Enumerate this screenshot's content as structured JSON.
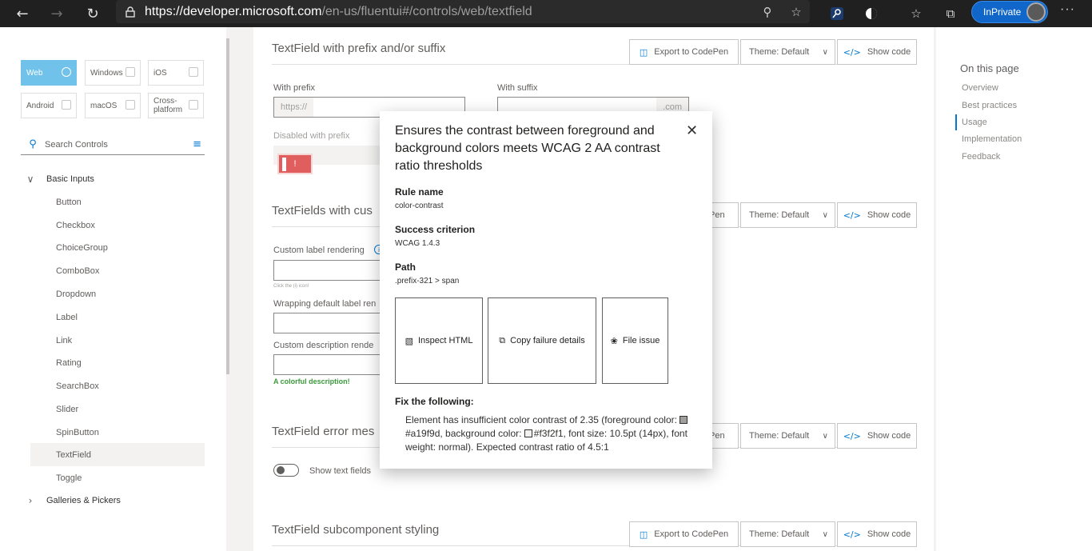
{
  "browser": {
    "url_host": "https://developer.microsoft.com",
    "url_path": "/en-us/fluentui#/controls/web/textfield",
    "inprivate_label": "InPrivate"
  },
  "platforms": [
    {
      "label": "Web",
      "active": true
    },
    {
      "label": "Windows"
    },
    {
      "label": "iOS"
    },
    {
      "label": "Android"
    },
    {
      "label": "macOS"
    },
    {
      "label": "Cross-platform"
    }
  ],
  "search": {
    "placeholder": "Search Controls"
  },
  "nav": {
    "group_basic": "Basic Inputs",
    "items": [
      "Button",
      "Checkbox",
      "ChoiceGroup",
      "ComboBox",
      "Dropdown",
      "Label",
      "Link",
      "Rating",
      "SearchBox",
      "Slider",
      "SpinButton",
      "TextField",
      "Toggle"
    ],
    "selected": "TextField",
    "group_galleries": "Galleries & Pickers"
  },
  "sections": [
    {
      "title": "TextField with prefix and/or suffix"
    },
    {
      "title": "TextFields with cus"
    },
    {
      "title": "TextField error mes"
    },
    {
      "title": "TextField subcomponent styling"
    }
  ],
  "toolbar": {
    "export_label": "Export to CodePen",
    "theme_label": "Theme: Default",
    "show_code_label": "Show code",
    "export_partial": "Pen"
  },
  "fields": {
    "with_prefix_label": "With prefix",
    "prefix_value": "https://",
    "with_suffix_label": "With suffix",
    "suffix_value": ".com",
    "disabled_prefix_label": "Disabled with prefix",
    "error_glyph": "!",
    "custom_label": "Custom label rendering",
    "info_glyph": "i",
    "click_hint": "Click the (i) icon!",
    "wrapping_label": "Wrapping default label ren",
    "custom_desc_label": "Custom description rende",
    "colorful_desc": "A colorful description!",
    "show_text_fields": "Show text fields"
  },
  "on_this_page": {
    "title": "On this page",
    "links": [
      "Overview",
      "Best practices",
      "Usage",
      "Implementation",
      "Feedback"
    ],
    "active": "Usage"
  },
  "dialog": {
    "title": "Ensures the contrast between foreground and background colors meets WCAG 2 AA contrast ratio thresholds",
    "rule_name_label": "Rule name",
    "rule_name_value": "color-contrast",
    "success_label": "Success criterion",
    "success_value": "WCAG 1.4.3",
    "path_label": "Path",
    "path_value": ".prefix-321 > span",
    "inspect_label": "Inspect HTML",
    "copy_label": "Copy failure details",
    "file_label": "File issue",
    "fix_label": "Fix the following:",
    "fix_part1": "Element has insufficient color contrast of 2.35 (foreground color: ",
    "fg_hex": "#a19f9d",
    "fix_part2": ", background color: ",
    "bg_hex": "#f3f2f1",
    "fix_part3": ", font size: 10.5pt (14px), font weight: normal). Expected contrast ratio of 4.5:1",
    "fg_color": "#a19f9d",
    "bg_color": "#f3f2f1"
  },
  "colors": {
    "accent": "#0078d4",
    "web_active": "#71c2ea",
    "inprivate": "#1067c9",
    "error": "#e05e5e"
  }
}
